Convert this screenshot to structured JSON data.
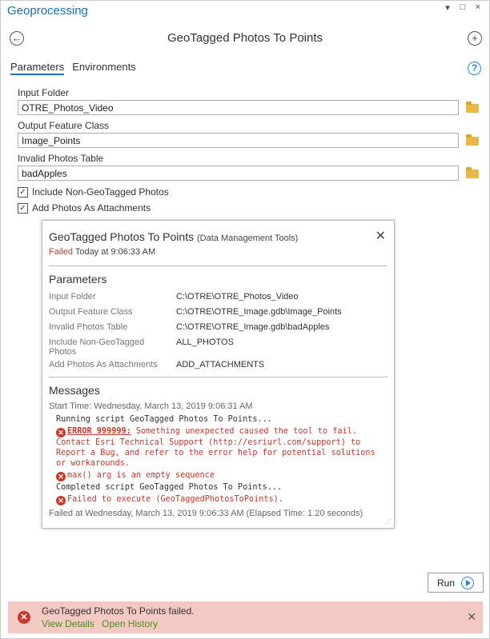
{
  "pane": {
    "title": "Geoprocessing",
    "controls": [
      "▾",
      "□",
      "×"
    ]
  },
  "tool": {
    "title": "GeoTagged Photos To Points"
  },
  "tabs": [
    "Parameters",
    "Environments"
  ],
  "params": {
    "input_folder": {
      "label": "Input Folder",
      "value": "OTRE_Photos_Video"
    },
    "output_fc": {
      "label": "Output Feature Class",
      "value": "Image_Points"
    },
    "invalid_table": {
      "label": "Invalid Photos Table",
      "value": "badApples"
    },
    "include_nongeo": {
      "label": "Include Non-GeoTagged Photos",
      "checked": true
    },
    "add_attachments": {
      "label": "Add Photos As Attachments",
      "checked": true
    }
  },
  "popup": {
    "title": "GeoTagged Photos To Points",
    "toolbox": "(Data Management Tools)",
    "status": "Failed",
    "status_time": "Today at 9:06:33 AM",
    "params_heading": "Parameters",
    "rows": [
      {
        "key": "Input Folder",
        "value": "C:\\OTRE\\OTRE_Photos_Video"
      },
      {
        "key": "Output Feature Class",
        "value": "C:\\OTRE\\OTRE_Image.gdb\\Image_Points"
      },
      {
        "key": "Invalid Photos Table",
        "value": "C:\\OTRE\\OTRE_Image.gdb\\badApples"
      },
      {
        "key": "Include Non-GeoTagged Photos",
        "value": "ALL_PHOTOS"
      },
      {
        "key": "Add Photos As Attachments",
        "value": "ADD_ATTACHMENTS"
      }
    ],
    "messages_heading": "Messages",
    "start_time": "Start Time: Wednesday, March 13, 2019 9:06:31 AM",
    "msg_running": "Running script GeoTagged Photos To Points...",
    "err_code": "ERROR 999999:",
    "err_text": " Something unexpected caused the tool to fail. Contact Esri Technical Support (http://esriurl.com/support) to Report a Bug, and refer to the error help for potential solutions or workarounds.",
    "err_max": "max() arg is an empty sequence",
    "msg_completed": "Completed script GeoTagged Photos To Points...",
    "err_failed": "Failed to execute (GeoTaggedPhotosToPoints).",
    "end_time": "Failed at Wednesday, March 13, 2019 9:06:33 AM (Elapsed Time: 1.20 seconds)"
  },
  "run_label": "Run",
  "banner": {
    "text": "GeoTagged Photos To Points failed.",
    "view_details": "View Details",
    "open_history": "Open History"
  },
  "colors": {
    "accent": "#1a6fb5",
    "error": "#c0392b",
    "banner_bg": "#f3c9c3",
    "link": "#4b8b1f"
  }
}
